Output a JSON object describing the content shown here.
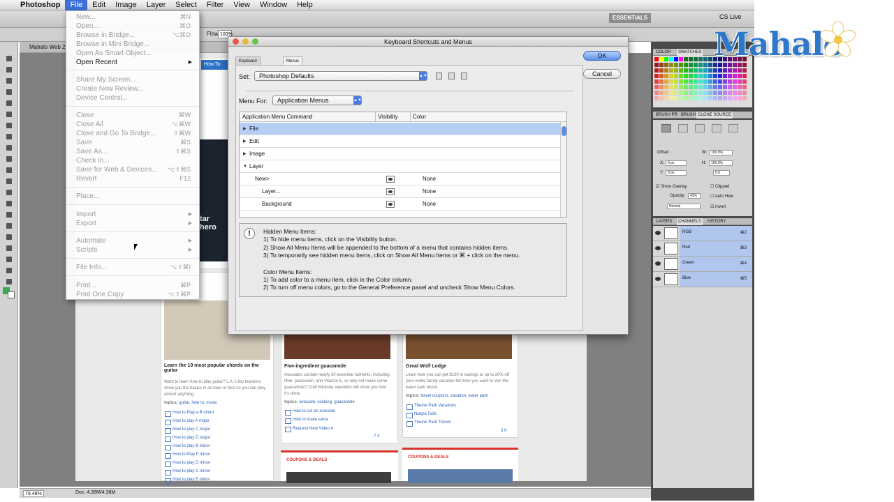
{
  "menubar": {
    "app_name": "Photoshop",
    "items": [
      "File",
      "Edit",
      "Image",
      "Layer",
      "Select",
      "Filter",
      "View",
      "Window",
      "Help"
    ],
    "active": "File"
  },
  "workspace": {
    "essentials_label": "ESSENTIALS",
    "cs_live_label": "CS Live",
    "flow_label": "Flow:",
    "flow_value": "100%",
    "document_tab": "Mahalo Web 2.p",
    "zoom_level": "79.48%",
    "doc_size": "Doc: 4.38M/4.38M"
  },
  "file_menu": {
    "items": [
      {
        "label": "New...",
        "shortcut": "⌘N",
        "enabled": false
      },
      {
        "label": "Open...",
        "shortcut": "⌘O",
        "enabled": false
      },
      {
        "label": "Browse in Bridge...",
        "shortcut": "⌥⌘O",
        "enabled": false
      },
      {
        "label": "Browse in Mini Bridge...",
        "shortcut": "",
        "enabled": false
      },
      {
        "label": "Open As Smart Object...",
        "shortcut": "",
        "enabled": false
      },
      {
        "label": "Open Recent",
        "shortcut": "",
        "enabled": true,
        "submenu": true
      },
      {
        "label": "Share My Screen...",
        "shortcut": "",
        "enabled": false
      },
      {
        "label": "Create New Review...",
        "shortcut": "",
        "enabled": false
      },
      {
        "label": "Device Central...",
        "shortcut": "",
        "enabled": false
      },
      {
        "label": "Close",
        "shortcut": "⌘W",
        "enabled": false
      },
      {
        "label": "Close All",
        "shortcut": "⌥⌘W",
        "enabled": false
      },
      {
        "label": "Close and Go To Bridge...",
        "shortcut": "⇧⌘W",
        "enabled": false
      },
      {
        "label": "Save",
        "shortcut": "⌘S",
        "enabled": false
      },
      {
        "label": "Save As...",
        "shortcut": "⇧⌘S",
        "enabled": false
      },
      {
        "label": "Check In...",
        "shortcut": "",
        "enabled": false
      },
      {
        "label": "Save for Web & Devices...",
        "shortcut": "⌥⇧⌘S",
        "enabled": false
      },
      {
        "label": "Revert",
        "shortcut": "F12",
        "enabled": false
      },
      {
        "label": "Place...",
        "shortcut": "",
        "enabled": false
      },
      {
        "label": "Import",
        "shortcut": "",
        "enabled": false,
        "submenu": true
      },
      {
        "label": "Export",
        "shortcut": "",
        "enabled": false,
        "submenu": true
      },
      {
        "label": "Automate",
        "shortcut": "",
        "enabled": false,
        "submenu": true
      },
      {
        "label": "Scripts",
        "shortcut": "",
        "enabled": false,
        "submenu": true
      },
      {
        "label": "File Info...",
        "shortcut": "⌥⇧⌘I",
        "enabled": false
      },
      {
        "label": "Print...",
        "shortcut": "⌘P",
        "enabled": false
      },
      {
        "label": "Print One Copy",
        "shortcut": "⌥⇧⌘P",
        "enabled": false
      }
    ]
  },
  "dialog": {
    "title": "Keyboard Shortcuts and Menus",
    "tabs": [
      "Keyboard Shortcuts",
      "Menus"
    ],
    "active_tab": "Menus",
    "set_label": "Set:",
    "set_value": "Photoshop Defaults",
    "menu_for_label": "Menu For:",
    "menu_for_value": "Application Menus",
    "table": {
      "columns": [
        "Application Menu Command",
        "Visibility",
        "Color"
      ],
      "rows": [
        {
          "label": "File",
          "level": 0,
          "expanded": false,
          "selected": true,
          "color": ""
        },
        {
          "label": "Edit",
          "level": 0,
          "expanded": false,
          "selected": false,
          "color": ""
        },
        {
          "label": "Image",
          "level": 0,
          "expanded": false,
          "selected": false,
          "color": ""
        },
        {
          "label": "Layer",
          "level": 0,
          "expanded": true,
          "selected": false,
          "color": ""
        },
        {
          "label": "New>",
          "level": 1,
          "expanded": false,
          "selected": false,
          "color": "None"
        },
        {
          "label": "Layer...",
          "level": 2,
          "expanded": false,
          "selected": false,
          "color": "None"
        },
        {
          "label": "Background",
          "level": 2,
          "expanded": false,
          "selected": false,
          "color": "None"
        }
      ]
    },
    "info": {
      "hidden_title": "Hidden Menu Items:",
      "hidden_1": "1) To hide menu items, click on the Visibility button.",
      "hidden_2": "2) Show All Menu Items will be appended to the bottom of a menu that contains hidden items.",
      "hidden_3": "3) To temporarily see hidden menu items, click on Show All Menu Items or ⌘ + click on the menu.",
      "color_title": "Color Menu Items:",
      "color_1": "1) To add color to a menu item, click in the Color column.",
      "color_2": "2) To turn off menu colors, go to the General Preference panel and uncheck Show Menu Colors."
    },
    "ok_label": "OK",
    "cancel_label": "Cancel"
  },
  "panels": {
    "color_tabs": [
      "COLOR",
      "SWATCHES"
    ],
    "clone_tabs": [
      "BRUSH PR",
      "BRUSH",
      "CLONE SOURCE"
    ],
    "clone": {
      "offset_label": "Offset:",
      "x_label": "X:",
      "x_value": "0 px",
      "y_label": "Y:",
      "y_value": "0 px",
      "w_label": "W:",
      "w_value": "100.0%",
      "h_label": "H:",
      "h_value": "100.0%",
      "angle_value": "0.0",
      "show_overlay": "Show Overlay",
      "clipped": "Clipped",
      "opacity_label": "Opacity:",
      "opacity_value": "43%",
      "auto_hide": "Auto Hide",
      "mode": "Normal",
      "invert": "Invert"
    },
    "layer_tabs": [
      "LAYERS",
      "CHANNELS",
      "HISTORY"
    ],
    "channels": [
      {
        "name": "RGB",
        "shortcut": "⌘2"
      },
      {
        "name": "Red",
        "shortcut": "⌘3"
      },
      {
        "name": "Green",
        "shortcut": "⌘4"
      },
      {
        "name": "Blue",
        "shortcut": "⌘5"
      }
    ]
  },
  "webpage": {
    "how_to": "How To",
    "hero_text": "tar hero",
    "cards": [
      {
        "title": "Learn the 10 most popular chords on the guitar",
        "desc": "Want to learn how to play guitar? L.A.'s top teachers show you the basics in an hour or less so you can play almost anything.",
        "topics_label": "topics:",
        "topics": "guitar, how to, music",
        "links": [
          "How to Play a B chord",
          "How to play A major",
          "How to play C major",
          "How to play D major",
          "How to play B minor",
          "How to Play F minor",
          "How to play D minor",
          "How to play C minor",
          "How to play E minor"
        ]
      },
      {
        "title": "Five-ingredient guacamole",
        "desc": "Avocados contain nearly 20 essential nutrients, including fiber, potassium, and Vitamin E, so why not make some guacamole? Chef Miranda Valentine will show you how it's done.",
        "topics_label": "topics:",
        "topics": "avocado, cooking, guacamole",
        "links": [
          "How to cut an avocado",
          "How to make salsa",
          "Request New Video ▾"
        ],
        "stats": "7   4"
      },
      {
        "title": "Great Wolf Lodge",
        "desc": "Learn how you can get $130 in savings or up to 20% off your entire family vacation the time you want to visit the water park resort.",
        "topics_label": "topics:",
        "topics": "travel coupons, vacation, water park",
        "links": [
          "Theme Park Vacations",
          "Niagra Falls",
          "Theme Park Tickets"
        ],
        "stats": "3   0"
      }
    ],
    "deal_label": "COUPONS & DEALS"
  },
  "colors": {
    "accent": "#3d6fd8",
    "selection": "#b6cdf4",
    "link": "#2b62b8",
    "deal": "#d9332a",
    "logo": "#2f78c8"
  },
  "brand": "Mahalo"
}
